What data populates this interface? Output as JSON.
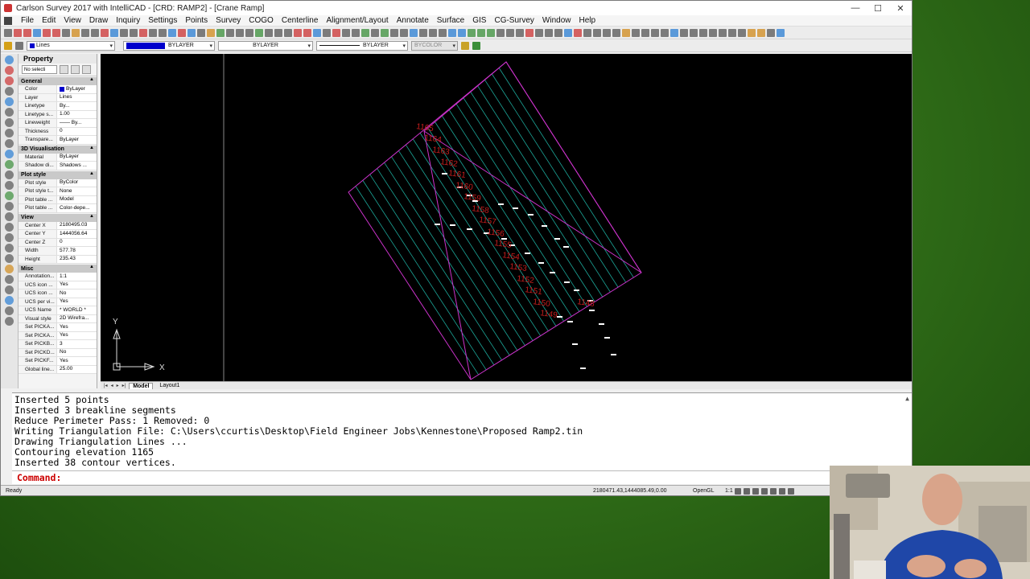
{
  "window": {
    "title": "Carlson Survey 2017 with IntelliCAD - [CRD: RAMP2] - [Crane Ramp]",
    "controls": [
      "—",
      "☐",
      "✕"
    ]
  },
  "menu": [
    "File",
    "Edit",
    "View",
    "Draw",
    "Inquiry",
    "Settings",
    "Points",
    "Survey",
    "COGO",
    "Centerline",
    "Alignment/Layout",
    "Annotate",
    "Surface",
    "GIS",
    "CG-Survey",
    "Window",
    "Help"
  ],
  "toolbar2": {
    "layer": "Lines",
    "color": "BYLAYER",
    "linetype": "BYLAYER",
    "lineweight": "BYLAYER",
    "plotstyle": "BYCOLOR"
  },
  "property_panel": {
    "title": "Property",
    "selection": "No selecti",
    "sections": [
      {
        "name": "General",
        "rows": [
          {
            "k": "Color",
            "v": "ByLayer",
            "swatch": true
          },
          {
            "k": "Layer",
            "v": "Lines"
          },
          {
            "k": "Linetype",
            "v": "By..."
          },
          {
            "k": "Linetype s...",
            "v": "1.00"
          },
          {
            "k": "Lineweight",
            "v": "—— By..."
          },
          {
            "k": "Thickness",
            "v": "0"
          },
          {
            "k": "Transpare...",
            "v": "ByLayer"
          }
        ]
      },
      {
        "name": "3D Visualisation",
        "rows": [
          {
            "k": "Material",
            "v": "ByLayer"
          },
          {
            "k": "Shadow di...",
            "v": "Shadows ..."
          }
        ]
      },
      {
        "name": "Plot style",
        "rows": [
          {
            "k": "Plot style",
            "v": "ByColor"
          },
          {
            "k": "Plot style t...",
            "v": "None"
          },
          {
            "k": "Plot table ...",
            "v": "Model"
          },
          {
            "k": "Plot table ...",
            "v": "Color-depe..."
          }
        ]
      },
      {
        "name": "View",
        "rows": [
          {
            "k": "Center X",
            "v": "2180495.03"
          },
          {
            "k": "Center Y",
            "v": "1444056.64"
          },
          {
            "k": "Center Z",
            "v": "0"
          },
          {
            "k": "Width",
            "v": "577.78"
          },
          {
            "k": "Height",
            "v": "235.43"
          }
        ]
      },
      {
        "name": "Misc",
        "rows": [
          {
            "k": "Annotation...",
            "v": "1:1"
          },
          {
            "k": "UCS icon ...",
            "v": "Yes"
          },
          {
            "k": "UCS icon ...",
            "v": "No"
          },
          {
            "k": "UCS per vi...",
            "v": "Yes"
          },
          {
            "k": "UCS Name",
            "v": "* WORLD *"
          },
          {
            "k": "Visual style",
            "v": "2D Wirefra..."
          },
          {
            "k": "Set PICKA...",
            "v": "Yes"
          },
          {
            "k": "Set PICKA...",
            "v": "Yes"
          },
          {
            "k": "Set PICKB...",
            "v": "3"
          },
          {
            "k": "Set PICKD...",
            "v": "No"
          },
          {
            "k": "Set PICKF...",
            "v": "Yes"
          },
          {
            "k": "Global line...",
            "v": "25.00"
          }
        ]
      }
    ]
  },
  "canvas": {
    "contour_labels": [
      "1165",
      "1164",
      "1163",
      "1162",
      "1161",
      "1160",
      "1159",
      "1158",
      "1157",
      "1156",
      "1155",
      "1154",
      "1153",
      "1152",
      "1151",
      "1150",
      "1149",
      "1148"
    ],
    "ucs": {
      "x": "X",
      "y": "Y"
    }
  },
  "tabs": {
    "model": "Model",
    "layout": "Layout1"
  },
  "command": {
    "lines": [
      "Inserted 5 points",
      "Inserted 3 breakline segments",
      "Reduce Perimeter Pass: 1 Removed: 0",
      "Writing Triangulation File: C:\\Users\\ccurtis\\Desktop\\Field Engineer Jobs\\Kennestone\\Proposed Ramp2.tin",
      "Drawing Triangulation Lines ...",
      "Contouring elevation 1165",
      "Inserted 38 contour vertices."
    ],
    "prompt": "Command:",
    "input": ""
  },
  "status": {
    "ready": "Ready",
    "coords": "2180471.43,1444085.49,0.00",
    "renderer": "OpenGL",
    "scale": "1:1"
  },
  "colors": {
    "contour": "#22c6b6",
    "boundary": "#cc33cc",
    "label": "#c81e1e",
    "points": "#ffffff",
    "canvas_bg": "#000000"
  }
}
